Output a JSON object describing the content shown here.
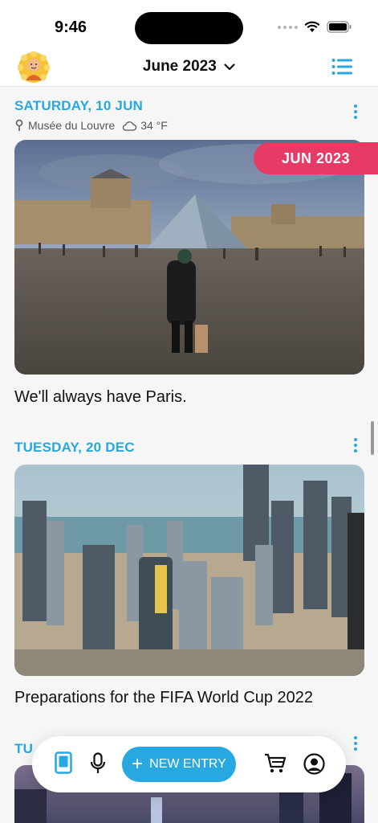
{
  "status_bar": {
    "time": "9:46"
  },
  "header": {
    "month_label": "June 2023"
  },
  "entries": [
    {
      "date": "SATURDAY, 10 JUN",
      "location": "Musée du Louvre",
      "weather": "34 °F",
      "badge": "JUN 2023",
      "text": "We'll always have Paris."
    },
    {
      "date": "TUESDAY, 20 DEC",
      "text": "Preparations for the FIFA World Cup 2022"
    },
    {
      "date": "TU"
    }
  ],
  "bottom_bar": {
    "new_entry_label": "NEW ENTRY"
  },
  "icons": {
    "accent": "#27a8e0",
    "badge": "#e73a65",
    "names": [
      "avatar",
      "chevron-down-icon",
      "list-icon",
      "more-icon",
      "pin-icon",
      "cloud-icon",
      "journal-icon",
      "microphone-icon",
      "plus-icon",
      "cart-icon",
      "profile-icon"
    ]
  }
}
